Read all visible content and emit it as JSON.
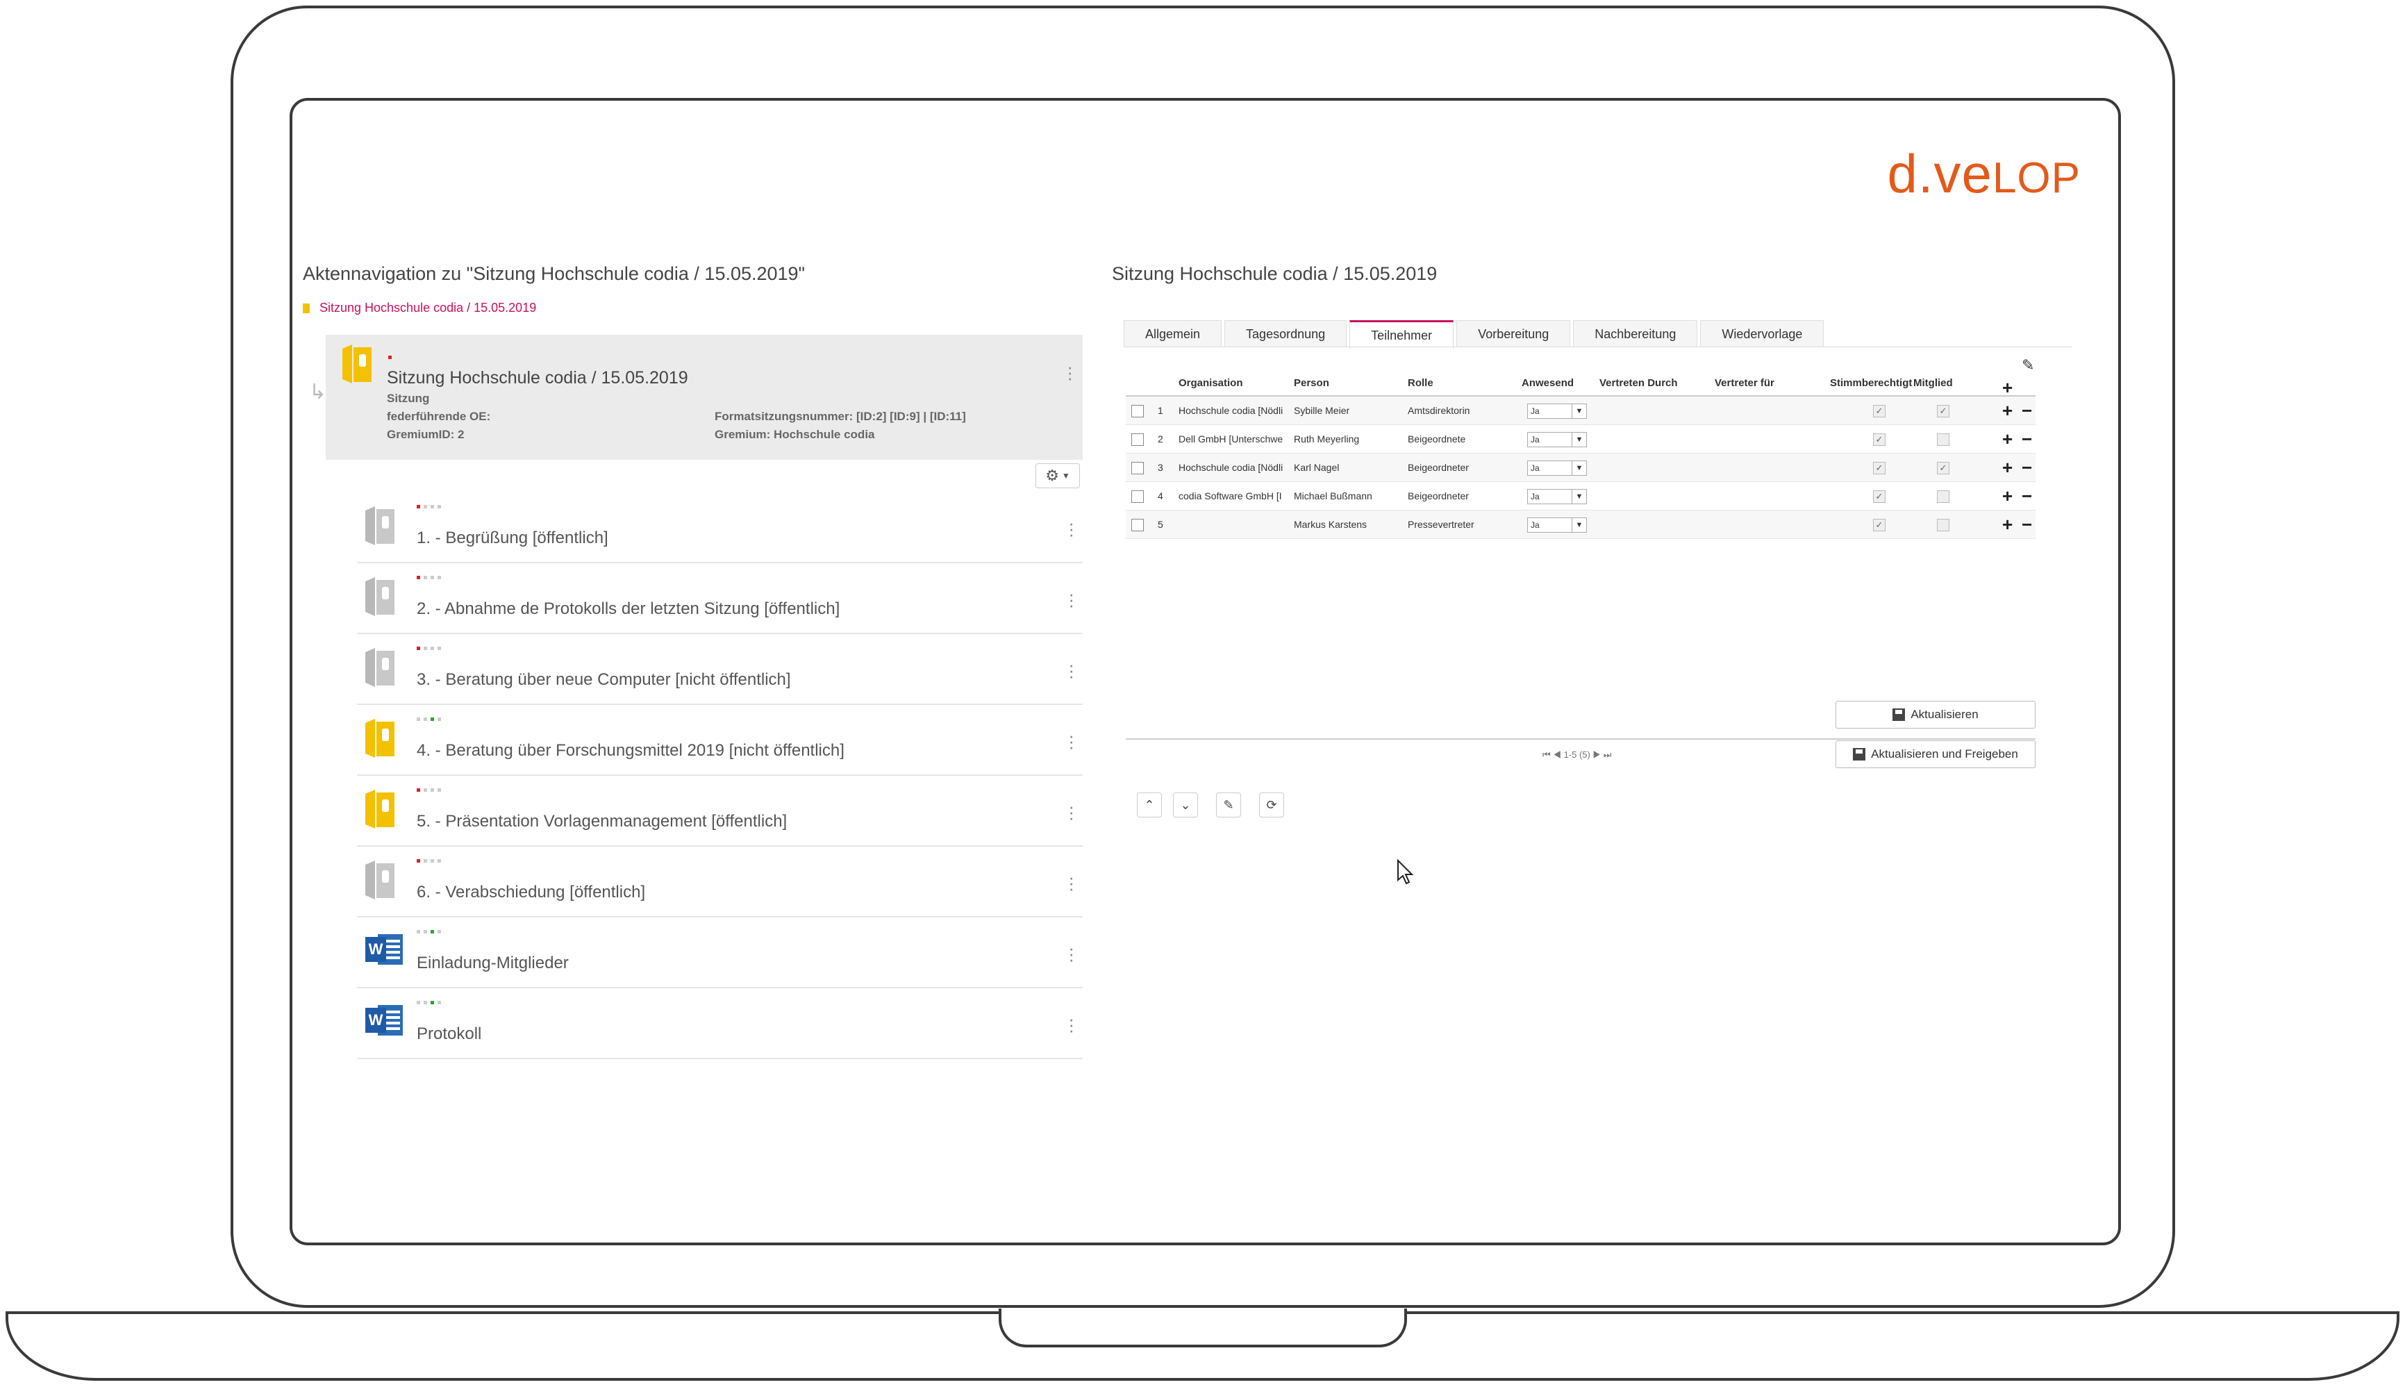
{
  "brand": {
    "logo_main": "d.ve",
    "logo_small": "LOP",
    "color": "#e35a1a"
  },
  "left": {
    "title": "Aktennavigation zu \"Sitzung Hochschule codia / 15.05.2019\"",
    "breadcrumb": "Sitzung Hochschule codia / 15.05.2019",
    "main": {
      "title": "Sitzung Hochschule codia / 15.05.2019",
      "type": "Sitzung",
      "oe_label": "federführende OE:",
      "gremium_id": "GremiumID: 2",
      "format": "Formatsitzungsnummer: [ID:2] [ID:9] | [ID:11]",
      "gremium": "Gremium: Hochschule codia"
    },
    "items": [
      {
        "label": "1. - Begrüßung [öffentlich]",
        "icon": "binder-grey-icon",
        "status": "red"
      },
      {
        "label": "2. - Abnahme de Protokolls der letzten Sitzung [öffentlich]",
        "icon": "binder-grey-icon",
        "status": "red"
      },
      {
        "label": "3. - Beratung über neue Computer [nicht öffentlich]",
        "icon": "binder-grey-icon",
        "status": "red"
      },
      {
        "label": "4. - Beratung über Forschungsmittel 2019 [nicht öffentlich]",
        "icon": "binder-yellow-icon",
        "status": "green"
      },
      {
        "label": "5. - Präsentation Vorlagenmanagement [öffentlich]",
        "icon": "binder-yellow-icon",
        "status": "red"
      },
      {
        "label": "6. - Verabschiedung [öffentlich]",
        "icon": "binder-grey-icon",
        "status": "red"
      },
      {
        "label": "Einladung-Mitglieder",
        "icon": "word-icon",
        "status": "green"
      },
      {
        "label": "Protokoll",
        "icon": "word-icon",
        "status": "green"
      }
    ]
  },
  "right": {
    "title": "Sitzung Hochschule codia / 15.05.2019",
    "tabs": [
      "Allgemein",
      "Tagesordnung",
      "Teilnehmer",
      "Vorbereitung",
      "Nachbereitung",
      "Wiedervorlage"
    ],
    "active_tab": "Teilnehmer",
    "columns": [
      "Organisation",
      "Person",
      "Rolle",
      "Anwesend",
      "Vertreten Durch",
      "Vertreter für",
      "Stimmberechtigt",
      "Mitglied"
    ],
    "rows": [
      {
        "nr": "1",
        "org": "Hochschule codia [Nödli",
        "person": "Sybille  Meier",
        "rolle": "Amtsdirektorin",
        "anwesend": "Ja",
        "stimm": "✓",
        "mitglied": "✓"
      },
      {
        "nr": "2",
        "org": "Dell GmbH [Unterschwe",
        "person": "Ruth  Meyerling",
        "rolle": "Beigeordnete",
        "anwesend": "Ja",
        "stimm": "✓",
        "mitglied": ""
      },
      {
        "nr": "3",
        "org": "Hochschule codia [Nödli",
        "person": "Karl  Nagel",
        "rolle": "Beigeordneter",
        "anwesend": "Ja",
        "stimm": "✓",
        "mitglied": "✓"
      },
      {
        "nr": "4",
        "org": "codia Software GmbH [I",
        "person": "Michael  Bußmann",
        "rolle": "Beigeordneter",
        "anwesend": "Ja",
        "stimm": "✓",
        "mitglied": ""
      },
      {
        "nr": "5",
        "org": "",
        "person": "Markus  Karstens",
        "rolle": "Pressevertreter",
        "anwesend": "Ja",
        "stimm": "✓",
        "mitglied": ""
      }
    ],
    "pager": "1-5 (5)",
    "btn_update": "Aktualisieren",
    "btn_update_release": "Aktualisieren und Freigeben"
  }
}
